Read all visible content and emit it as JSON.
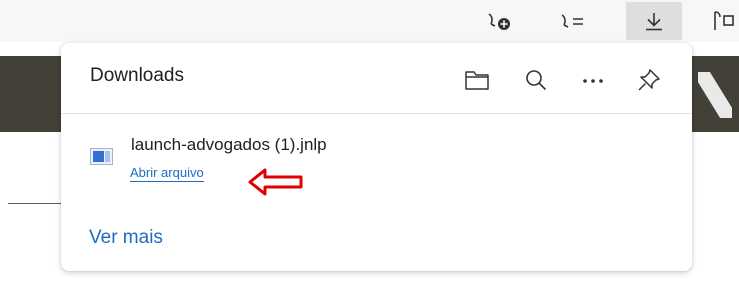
{
  "toolbar": {
    "buttons": [
      {
        "name": "add-collection-icon"
      },
      {
        "name": "favorites-list-icon"
      },
      {
        "name": "download-icon",
        "active": true
      },
      {
        "name": "collections-icon"
      }
    ]
  },
  "downloads": {
    "title": "Downloads",
    "header_icons": [
      "open-folder-icon",
      "search-icon",
      "more-options-icon",
      "pin-icon"
    ],
    "items": [
      {
        "file_name": "launch-advogados (1).jnlp",
        "action_label": "Abrir arquivo",
        "file_icon": "jnlp-file-icon"
      }
    ],
    "see_more_label": "Ver mais"
  },
  "annotation": {
    "shape": "left-arrow",
    "color": "#e00000"
  },
  "colors": {
    "link": "#1a6dc0",
    "page_band": "#424037",
    "toolbar_active": "#dedede"
  }
}
